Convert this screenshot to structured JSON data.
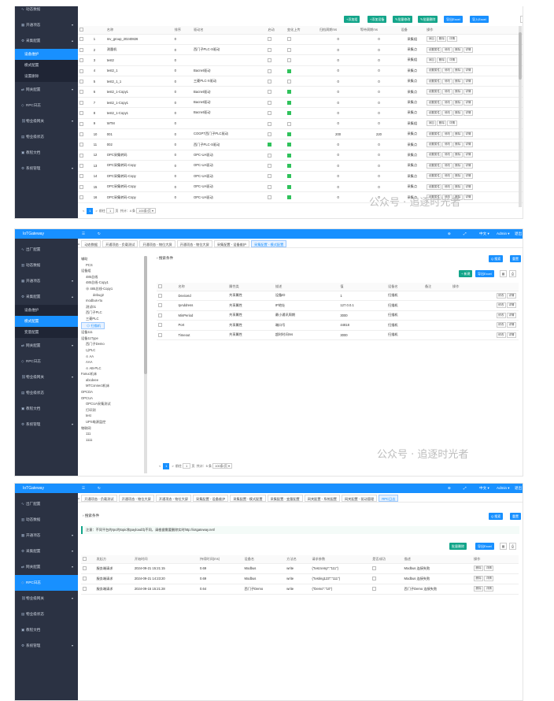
{
  "panel1": {
    "menu": [
      {
        "label": "动态数据",
        "icon": "wave-icon",
        "state": "normal"
      },
      {
        "label": "开通项态",
        "icon": "grid-icon",
        "state": "normal",
        "arrow": "▾"
      },
      {
        "label": "采集配置",
        "icon": "gear-icon",
        "state": "open",
        "arrow": "▴"
      },
      {
        "label": "设备维护",
        "icon": "",
        "state": "active-sub"
      },
      {
        "label": "模式配置",
        "icon": "",
        "state": "sub"
      },
      {
        "label": "设置删除",
        "icon": "",
        "state": "sub"
      },
      {
        "label": "网关配置",
        "icon": "share-icon",
        "state": "normal",
        "arrow": "▾"
      },
      {
        "label": "RPC日志",
        "icon": "rpc-icon",
        "state": "normal"
      },
      {
        "label": "物业级网关",
        "icon": "link-icon",
        "state": "normal",
        "arrow": "▾"
      },
      {
        "label": "物业级状态",
        "icon": "chart-icon",
        "state": "normal"
      },
      {
        "label": "教程文档",
        "icon": "doc-icon",
        "state": "normal"
      },
      {
        "label": "系统管理",
        "icon": "settings-icon",
        "state": "normal",
        "arrow": "▾"
      }
    ],
    "toolbar": [
      "+添加组",
      "+添加设备",
      "✎批量修改",
      "✎批量删除",
      "导出Excel",
      "导入Excel"
    ],
    "headers": [
      "",
      "",
      "名称",
      "排序",
      "驱动名",
      "启动",
      "变化上传",
      "归档周期ms",
      "等待周期ms",
      "设备",
      "操作"
    ],
    "rows": [
      {
        "no": "1",
        "name": "mv_group_20240826",
        "sort": "0",
        "driver": "",
        "enable": "",
        "change": false,
        "p1": "0",
        "p2": "0",
        "type": "采集组",
        "ops": [
          "添加",
          "删除",
          "详情"
        ]
      },
      {
        "no": "2",
        "name": "测量机",
        "sort": "0",
        "driver": "西门子PLC-S驱动",
        "enable": "",
        "change": false,
        "p1": "0",
        "p2": "0",
        "type": "采集点",
        "ops": [
          "设置属性",
          "修改",
          "删除",
          "详情"
        ]
      },
      {
        "no": "3",
        "name": "test2",
        "sort": "0",
        "driver": "",
        "enable": "",
        "change": false,
        "p1": "0",
        "p2": "0",
        "type": "采集组",
        "ops": [
          "添加",
          "删除",
          "详情"
        ]
      },
      {
        "no": "4",
        "name": "test2_1",
        "sort": "0",
        "driver": "Bacnet驱动",
        "enable": "",
        "change": true,
        "p1": "0",
        "p2": "0",
        "type": "采集点",
        "ops": [
          "设置属性",
          "修改",
          "删除",
          "详情"
        ]
      },
      {
        "no": "5",
        "name": "test2_1_1",
        "sort": "0",
        "driver": "三菱PLC-X驱动",
        "enable": "",
        "change": false,
        "p1": "0",
        "p2": "0",
        "type": "采集点",
        "ops": [
          "设置属性",
          "修改",
          "删除",
          "详情"
        ]
      },
      {
        "no": "6",
        "name": "test2_1-Copy1",
        "sort": "0",
        "driver": "Bacnet驱动",
        "enable": "",
        "change": true,
        "p1": "0",
        "p2": "0",
        "type": "采集点",
        "ops": [
          "设置属性",
          "修改",
          "删除",
          "详情"
        ]
      },
      {
        "no": "7",
        "name": "test2_1-Copy1",
        "sort": "0",
        "driver": "Bacnet驱动",
        "enable": "",
        "change": true,
        "p1": "0",
        "p2": "0",
        "type": "采集点",
        "ops": [
          "设置属性",
          "修改",
          "删除",
          "详情"
        ]
      },
      {
        "no": "8",
        "name": "test2_1-Copy1",
        "sort": "0",
        "driver": "Bacnet驱动",
        "enable": "",
        "change": true,
        "p1": "0",
        "p2": "0",
        "type": "采集点",
        "ops": [
          "设置属性",
          "修改",
          "删除",
          "详情"
        ]
      },
      {
        "no": "9",
        "name": "WTM",
        "sort": "0",
        "driver": "",
        "enable": "",
        "change": false,
        "p1": "0",
        "p2": "0",
        "type": "采集组",
        "ops": [
          "添加",
          "删除",
          "详情"
        ]
      },
      {
        "no": "10",
        "name": "001",
        "sort": "0",
        "driver": "COGPT西门子PLC驱动",
        "enable": "",
        "change": true,
        "p1": "200",
        "p2": "220",
        "type": "采集点",
        "ops": [
          "设置属性",
          "修改",
          "删除",
          "详情"
        ]
      },
      {
        "no": "11",
        "name": "002",
        "sort": "0",
        "driver": "西门子PLC-S驱动",
        "enable": "on",
        "change": true,
        "p1": "0",
        "p2": "0",
        "type": "采集点",
        "ops": [
          "设置属性",
          "修改",
          "删除",
          "详情"
        ]
      },
      {
        "no": "12",
        "name": "OPC采集转码",
        "sort": "0",
        "driver": "OPC-UA驱动",
        "enable": "",
        "change": true,
        "p1": "0",
        "p2": "0",
        "type": "采集点",
        "ops": [
          "设置属性",
          "修改",
          "删除",
          "详情"
        ]
      },
      {
        "no": "13",
        "name": "OPC采集转码-Copy",
        "sort": "0",
        "driver": "OPC-UA驱动",
        "enable": "",
        "change": true,
        "p1": "0",
        "p2": "0",
        "type": "采集点",
        "ops": [
          "设置属性",
          "修改",
          "删除",
          "详情"
        ]
      },
      {
        "no": "14",
        "name": "OPC采集转码-Copy",
        "sort": "0",
        "driver": "OPC-UA驱动",
        "enable": "",
        "change": true,
        "p1": "0",
        "p2": "0",
        "type": "采集点",
        "ops": [
          "设置属性",
          "修改",
          "删除",
          "详情"
        ]
      },
      {
        "no": "15",
        "name": "OPC采集转码-Copy",
        "sort": "0",
        "driver": "OPC-UA驱动",
        "enable": "",
        "change": true,
        "p1": "0",
        "p2": "0",
        "type": "采集点",
        "ops": [
          "设置属性",
          "修改",
          "删除",
          "详情"
        ]
      },
      {
        "no": "16",
        "name": "OPC采集转码-Copy",
        "sort": "0",
        "driver": "OPC-UA驱动",
        "enable": "",
        "change": true,
        "p1": "0",
        "p2": "0",
        "type": "采集点",
        "ops": [
          "设置属性",
          "修改",
          "删除",
          "详情"
        ]
      }
    ],
    "pager": {
      "prev": "<",
      "page": "1",
      "next": ">",
      "goto": "前往",
      "page_input": "1",
      "page_unit": "页",
      "total": "共计：",
      "total_count": "4 条",
      "size": "100条/页 ▾"
    },
    "watermark": "公众号 · 追逐时光者"
  },
  "panel2": {
    "logo": "IoTGateway",
    "menu": [
      {
        "label": "出厂配置",
        "icon": "wave-icon",
        "state": "normal"
      },
      {
        "label": "动态数据",
        "icon": "data-icon",
        "state": "normal"
      },
      {
        "label": "开通项态",
        "icon": "grid-icon",
        "state": "normal",
        "arrow": "▾"
      },
      {
        "label": "采集配置",
        "icon": "gear-icon",
        "state": "open",
        "arrow": "▴"
      },
      {
        "label": "设备维护",
        "icon": "",
        "state": "sub"
      },
      {
        "label": "模式配置",
        "icon": "",
        "state": "active-sub"
      },
      {
        "label": "变量配置",
        "icon": "",
        "state": "sub"
      },
      {
        "label": "网关配置",
        "icon": "share-icon",
        "state": "normal",
        "arrow": "▾"
      },
      {
        "label": "RPC日志",
        "icon": "rpc-icon",
        "state": "normal"
      },
      {
        "label": "物业级网关",
        "icon": "link-icon",
        "state": "normal",
        "arrow": "▾"
      },
      {
        "label": "物业级状态",
        "icon": "chart-icon",
        "state": "normal"
      },
      {
        "label": "教程文档",
        "icon": "doc-icon",
        "state": "normal"
      },
      {
        "label": "系统管理",
        "icon": "settings-icon",
        "state": "normal",
        "arrow": "▾"
      }
    ],
    "topbar": {
      "lang": "中文 ▾",
      "user": "Admin ▾",
      "exit": "退出"
    },
    "tabs": [
      "动态数据",
      "开通项态 - 负载测试",
      "开通项态 - 物位大屏",
      "开通项态 - 物位大屏",
      "采集配置 - 设备维护",
      "采集配置 - 模式配置"
    ],
    "search_label": "搜索条件",
    "search_btn": "Q 搜索",
    "reset_btn": "重置",
    "add_btn": "+ 新建",
    "export_btn": "导出Excel",
    "tree": [
      "辅助",
      "  PCS",
      "设备组",
      "  485总线",
      "  485总线-Copy1",
      "  ⊕ 485总线-Copy1",
      "     debug2",
      "  modbus-rtu",
      "  测试01",
      "  西门子PLC",
      "  三菱PLC",
      "  ⊙ 扫描机",
      "设备111",
      "设备11Type",
      "  西门子Demo",
      "  以PLC",
      "  ⊙ AA",
      "  AAA",
      "  ⊙ AB-PLC",
      "Fanuc机床",
      "  abcdeee",
      "  MTConnect机床",
      "OPCDA",
      "OPCUA",
      "  OPCUA采集测试",
      "  打印测",
      "  test",
      "  UPS电源监控",
      "物联网",
      "  111",
      "  1111"
    ],
    "headers": [
      "",
      "名称",
      "属性类",
      "描述",
      "值",
      "设备名",
      "备注",
      "操作"
    ],
    "rows": [
      {
        "name": "DeviceId",
        "cls": "共享属性",
        "desc": "设备ID",
        "val": "1",
        "dev": "扫描机",
        "note": "",
        "ops": [
          "修改",
          "详情"
        ]
      },
      {
        "name": "IpAddress",
        "cls": "共享属性",
        "desc": "IP地址",
        "val": "127.0.0.1",
        "dev": "扫描机",
        "note": "",
        "ops": [
          "修改",
          "详情"
        ]
      },
      {
        "name": "MinPeriod",
        "cls": "共享属性",
        "desc": "最小通讯周期",
        "val": "3000",
        "dev": "扫描机",
        "note": "",
        "ops": [
          "修改",
          "详情"
        ]
      },
      {
        "name": "Port",
        "cls": "共享属性",
        "desc": "端口号",
        "val": "44818",
        "dev": "扫描机",
        "note": "",
        "ops": [
          "修改",
          "详情"
        ]
      },
      {
        "name": "Timeout",
        "cls": "共享属性",
        "desc": "超时时间ms",
        "val": "3000",
        "dev": "扫描机",
        "note": "",
        "ops": [
          "修改",
          "详情"
        ]
      }
    ],
    "pager": {
      "prev": "<",
      "page": "1",
      "next": ">",
      "goto": "前往",
      "page_input": "1",
      "page_unit": "页",
      "total": "共计：",
      "total_count": "5 条",
      "size": "100条/页 ▾"
    },
    "watermark": "公众号 · 追逐时光者"
  },
  "panel3": {
    "logo": "IoTGateway",
    "menu": [
      {
        "label": "出厂配置",
        "icon": "wave-icon",
        "state": "normal"
      },
      {
        "label": "动态数据",
        "icon": "data-icon",
        "state": "normal"
      },
      {
        "label": "开通项态",
        "icon": "grid-icon",
        "state": "normal",
        "arrow": "▾"
      },
      {
        "label": "采集配置",
        "icon": "gear-icon",
        "state": "normal",
        "arrow": "▾"
      },
      {
        "label": "网关配置",
        "icon": "share-icon",
        "state": "normal",
        "arrow": "▾"
      },
      {
        "label": "RPC日志",
        "icon": "rpc-icon",
        "state": "active"
      },
      {
        "label": "物业级网关",
        "icon": "link-icon",
        "state": "normal",
        "arrow": "▾"
      },
      {
        "label": "物业级状态",
        "icon": "chart-icon",
        "state": "normal"
      },
      {
        "label": "教程文档",
        "icon": "doc-icon",
        "state": "normal"
      },
      {
        "label": "系统管理",
        "icon": "settings-icon",
        "state": "normal",
        "arrow": "▾"
      }
    ],
    "topbar": {
      "lang": "中文 ▾",
      "user": "Admin ▾",
      "exit": "退出"
    },
    "tabs": [
      "开通项态 - 负载测试",
      "开通项态 - 物位大屏",
      "开通项态 - 物位大屏",
      "采集配置 - 设备维护",
      "采集配置 - 模式配置",
      "采集配置 - 变量配置",
      "网关配置 - 系统配置",
      "网关配置 - 驱动管理",
      "RPC日志"
    ],
    "search_label": "搜索条件",
    "search_btn": "Q 搜索",
    "reset_btn": "重置",
    "notice": "注意：不同平台的rpc的topic和payload均不同，请根据需要删除实时http://iotgateway.net/",
    "clear_btn": "批量删除",
    "export_btn": "导出Excel",
    "headers": [
      "",
      "发起方",
      "开始时间",
      "持续时间(ms)",
      "设备名",
      "方法名",
      "请求参数",
      "是否成功",
      "描述",
      "操作"
    ],
    "rows": [
      {
        "src": "服务端请求",
        "start": "2024-09-21 15:21:15",
        "dur": "0.69",
        "dev": "Modbus",
        "method": "write",
        "params": "{\"test.temp\":\"111\"}",
        "ok": "",
        "desc": "Modbus 连接失败",
        "ops": [
          "删除",
          "详情"
        ]
      },
      {
        "src": "服务端请求",
        "start": "2024-09-21 14:23:20",
        "dur": "0.69",
        "dev": "Modbus",
        "method": "write",
        "params": "{\"testing123\":\"111\"}",
        "ok": "",
        "desc": "Modbus 连接失败",
        "ops": [
          "删除",
          "详情"
        ]
      },
      {
        "src": "服务端请求",
        "start": "2024-09-15 15:21:28",
        "dur": "0.64",
        "dev": "西门子Demo",
        "method": "write",
        "params": "{\"Demo\":\"10\"}",
        "ok": "",
        "desc": "西门子Demo 连接失败",
        "ops": [
          "删除",
          "详情"
        ]
      }
    ]
  }
}
